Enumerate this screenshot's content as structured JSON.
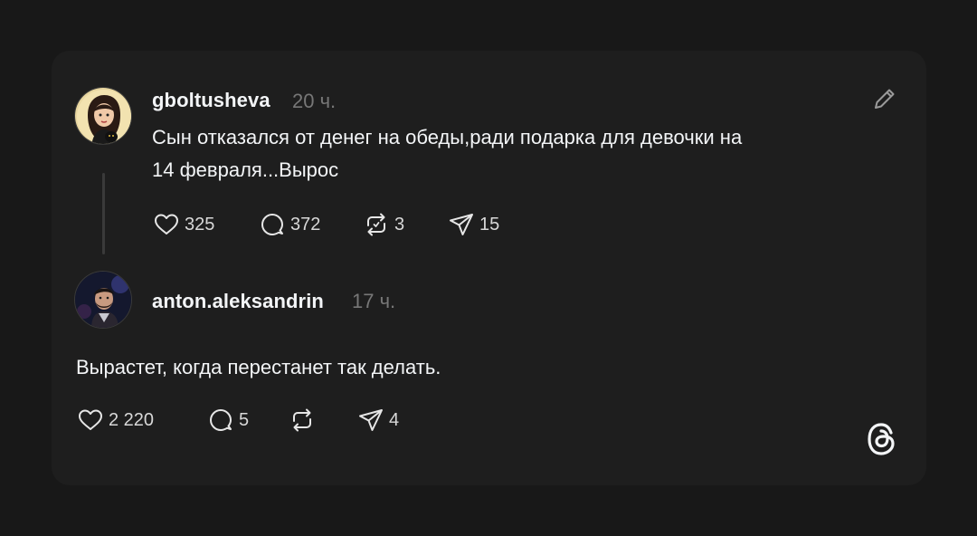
{
  "post": {
    "username": "gboltusheva",
    "time": "20 ч.",
    "text_line1": "Сын отказался от денег на обеды,ради подарка для девочки на",
    "text_line2": "14 февраля...Вырос",
    "likes": "325",
    "replies": "372",
    "reposts": "3",
    "shares": "15"
  },
  "reply": {
    "username": "anton.aleksandrin",
    "time": "17 ч.",
    "text": "Вырастет, когда перестанет так делать.",
    "likes": "2 220",
    "replies": "5",
    "shares": "4"
  },
  "icons": {
    "edit": "pencil-icon",
    "like": "heart-icon",
    "reply": "comment-bubble-icon",
    "repost": "repost-icon",
    "share": "send-icon",
    "logo": "threads-logo-icon"
  },
  "colors": {
    "page_bg": "#181818",
    "card_bg": "#1e1e1e",
    "text_primary": "#f3f5f7",
    "text_secondary": "#777777"
  }
}
